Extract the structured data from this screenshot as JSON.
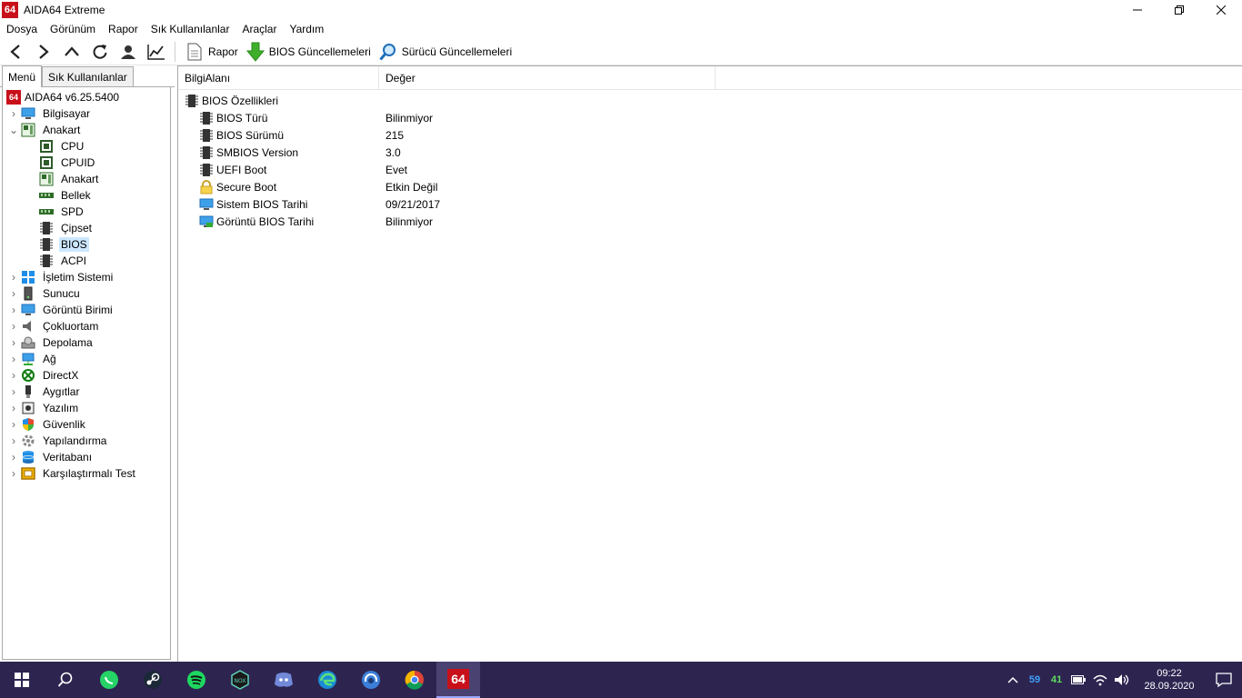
{
  "window": {
    "title": "AIDA64 Extreme",
    "logo_text": "64"
  },
  "menu": [
    "Dosya",
    "Görünüm",
    "Rapor",
    "Sık Kullanılanlar",
    "Araçlar",
    "Yardım"
  ],
  "toolbar": {
    "report_label": "Rapor",
    "bios_update_label": "BIOS Güncellemeleri",
    "driver_update_label": "Sürücü Güncellemeleri"
  },
  "tabs": {
    "menu": "Menü",
    "favorites": "Sık Kullanılanlar"
  },
  "tree": {
    "root": "AIDA64 v6.25.5400",
    "items": [
      {
        "label": "Bilgisayar"
      },
      {
        "label": "Anakart"
      },
      {
        "label": "CPU"
      },
      {
        "label": "CPUID"
      },
      {
        "label": "Anakart"
      },
      {
        "label": "Bellek"
      },
      {
        "label": "SPD"
      },
      {
        "label": "Çipset"
      },
      {
        "label": "BIOS"
      },
      {
        "label": "ACPI"
      },
      {
        "label": "İşletim Sistemi"
      },
      {
        "label": "Sunucu"
      },
      {
        "label": "Görüntü Birimi"
      },
      {
        "label": "Çokluortam"
      },
      {
        "label": "Depolama"
      },
      {
        "label": "Ağ"
      },
      {
        "label": "DirectX"
      },
      {
        "label": "Aygıtlar"
      },
      {
        "label": "Yazılım"
      },
      {
        "label": "Güvenlik"
      },
      {
        "label": "Yapılandırma"
      },
      {
        "label": "Veritabanı"
      },
      {
        "label": "Karşılaştırmalı Test"
      }
    ]
  },
  "columns": {
    "field": "BilgiAlanı",
    "value": "Değer"
  },
  "details": {
    "group": "BIOS Özellikleri",
    "rows": [
      {
        "field": "BIOS Türü",
        "value": "Bilinmiyor"
      },
      {
        "field": "BIOS Sürümü",
        "value": "215"
      },
      {
        "field": "SMBIOS Version",
        "value": "3.0"
      },
      {
        "field": "UEFI Boot",
        "value": "Evet"
      },
      {
        "field": "Secure Boot",
        "value": "Etkin Değil"
      },
      {
        "field": "Sistem BIOS Tarihi",
        "value": "09/21/2017"
      },
      {
        "field": "Görüntü BIOS Tarihi",
        "value": "Bilinmiyor"
      }
    ]
  },
  "taskbar": {
    "active_app_label": "64",
    "tray_cpu_temp": "59",
    "tray_gpu_temp": "41",
    "clock_time": "09:22",
    "clock_date": "28.09.2020"
  },
  "colors": {
    "accent": "#c8101a",
    "taskbar": "#2d2550",
    "selection": "#cce8ff"
  }
}
